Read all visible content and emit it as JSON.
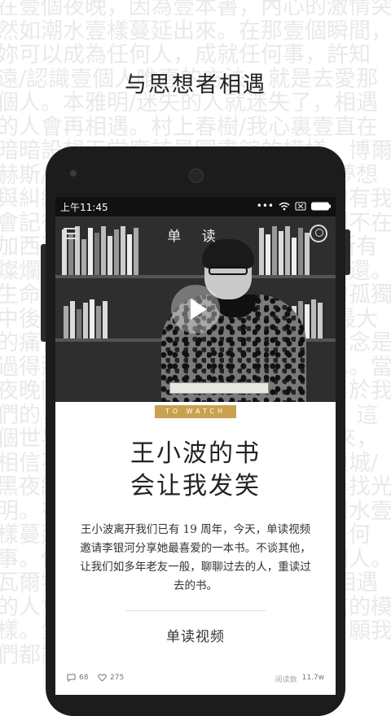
{
  "background_text": "在壹個夜晚，因為壹本書，內心的激情突然如潮水壹樣蔓延出來。在那壹個瞬間，妳可以成為任何人，成就任何事，許知遠/認識壹個人唯壹的方法，就是去愛那個人。本雅明/迷失的人就迷失了，相遇的人會再相遇。村上春樹/我心裏壹直在暗暗設想天堂應該是圖書館的模樣。博爾赫斯/沒有生活的真實，只有纏繞的夢想與糾纏的願我們都能如果回憶是大的有我會記得現在有那是你的話，無時無刻不在加西亞馬爾克斯/生命中曾經有過的所有燦爛，原來終究，都需要用寂寞來償還。生命是壹場大夢，是我們的不可知的孤獨中後我們的是感到了身體上的存在/最大的痛苦是壹種傷心，遠不如不要的懸念是過得那麼好，孤獨的，還是我們自己。當夜晚降臨，和人生的每個可能都有屬於我們的，需要，余華/如果沒有那個人，這個世界沒有回來失望。食指/相信未來，相信不屈不撓的努力，相信生命。顧城/黑夜給了我黑色的眼睛，我卻用它尋找光明。在壹個夜晚，因為壹本書，如潮水壹樣蔓延出來，以成為任何人，成就任何事。個人唯壹的方法，就是去愛那個人。瓦爾特本雅明/迷失的人就迷失了，相遇的人會再相遇。想天堂應該是圖書館的模樣。生活的真實，只有纏繞的夢想。願我們都能夠。",
  "headline": "与思想者相遇",
  "status": {
    "time": "上午11:45",
    "icons": [
      "dots-icon",
      "wifi-icon",
      "no-sim-icon",
      "battery-icon"
    ]
  },
  "app": {
    "title": "单 读"
  },
  "tag": "TO WATCH",
  "article": {
    "title_line1": "王小波的书",
    "title_line2": "会让我发笑",
    "body": "王小波离开我们已有 19 周年，今天，单读视频邀请李银河分享她最喜爱的一本书。不谈其他，让我们如多年老友一般，聊聊过去的人，重读过去的书。",
    "source": "单读视频"
  },
  "footer": {
    "comments": "68",
    "likes": "275",
    "reads_label": "阅读数",
    "reads": "11.7w"
  },
  "colors": {
    "accent": "#c9a24f",
    "phone": "#1c1c1c"
  }
}
